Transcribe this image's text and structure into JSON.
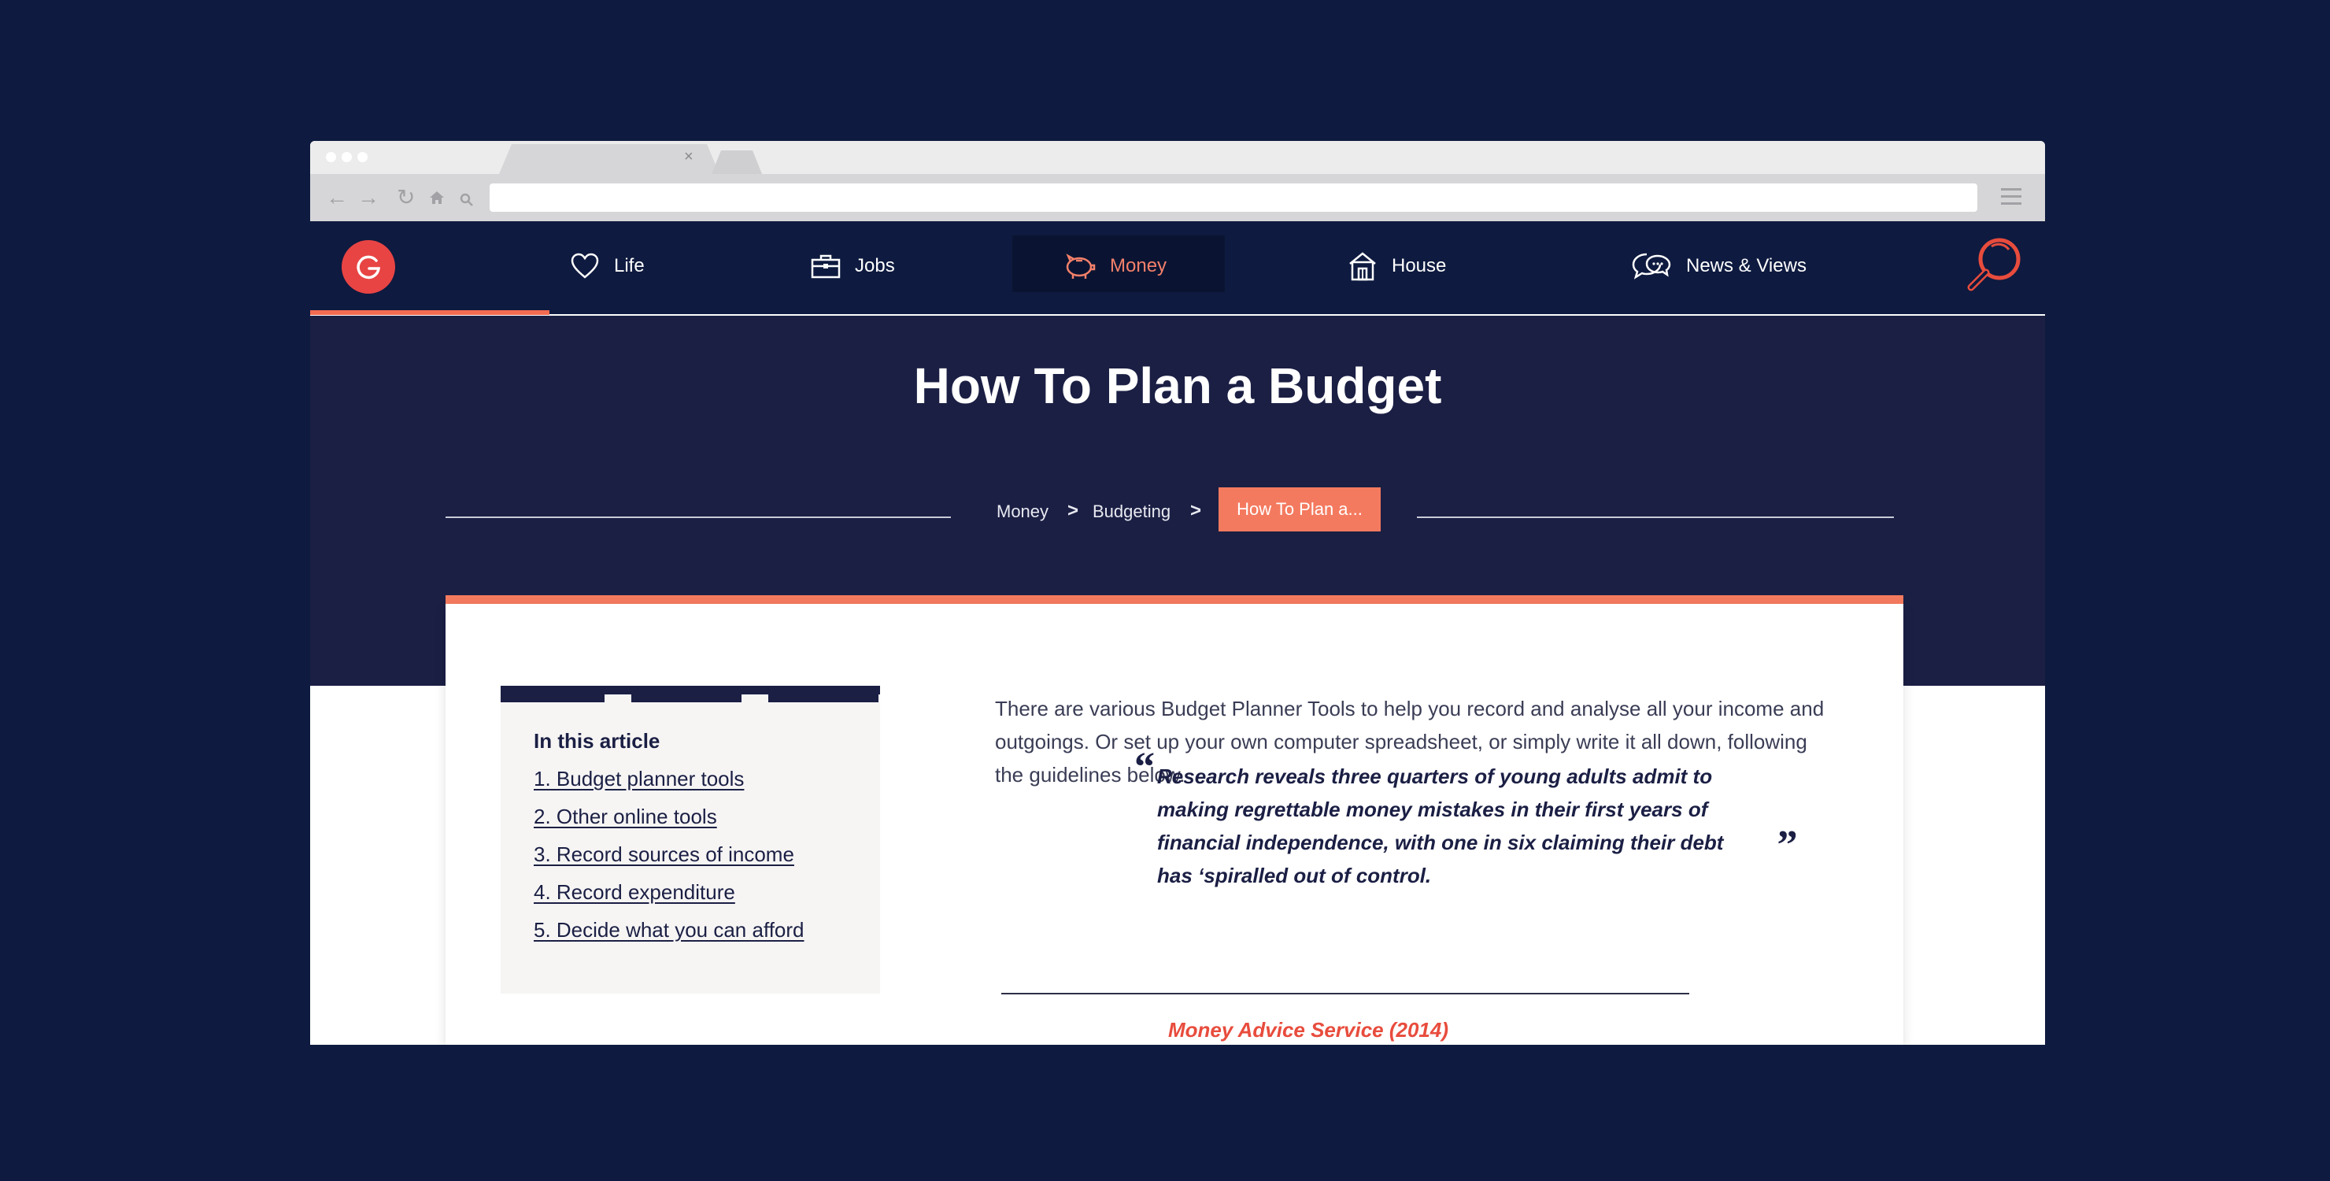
{
  "browser": {
    "tab_close": "×"
  },
  "site_nav": {
    "items": [
      {
        "label": "Life",
        "icon": "heart-icon"
      },
      {
        "label": "Jobs",
        "icon": "briefcase-icon"
      },
      {
        "label": "Money",
        "icon": "piggy-bank-icon",
        "active": true
      },
      {
        "label": "House",
        "icon": "house-icon"
      },
      {
        "label": "News & Views",
        "icon": "chat-bubbles-icon"
      }
    ],
    "logo_icon": "logo-icon",
    "search_icon": "search-icon"
  },
  "hero": {
    "title": "How To Plan a Budget",
    "breadcrumb": [
      {
        "label": "Money"
      },
      {
        "label": "Budgeting"
      },
      {
        "label": "How To Plan a..."
      }
    ],
    "separator": ">"
  },
  "toc": {
    "heading": "In this article",
    "items": [
      {
        "label": "1. Budget planner tools"
      },
      {
        "label": "2. Other online tools"
      },
      {
        "label": "3. Record sources of income"
      },
      {
        "label": "4. Record expenditure"
      },
      {
        "label": "5. Decide what you can afford"
      }
    ]
  },
  "article": {
    "intro": "There are various Budget Planner Tools to help you record and analyse all your income and outgoings. Or set up your own computer spreadsheet, or simply write it all down, following the guidelines below.",
    "quote": "Research reveals three quarters of young adults admit to making regrettable money mistakes in their first years of financial independence, with one in six claiming their debt has ‘spiralled out of control.",
    "quote_open": "“",
    "quote_close": "„",
    "quote_source": "Money Advice Service (2014)"
  },
  "colors": {
    "page_bg": "#0e1a3f",
    "hero_bg": "#1b1f44",
    "accent": "#f47a5f",
    "logo_red": "#e84444",
    "source_red": "#e84c3d"
  }
}
